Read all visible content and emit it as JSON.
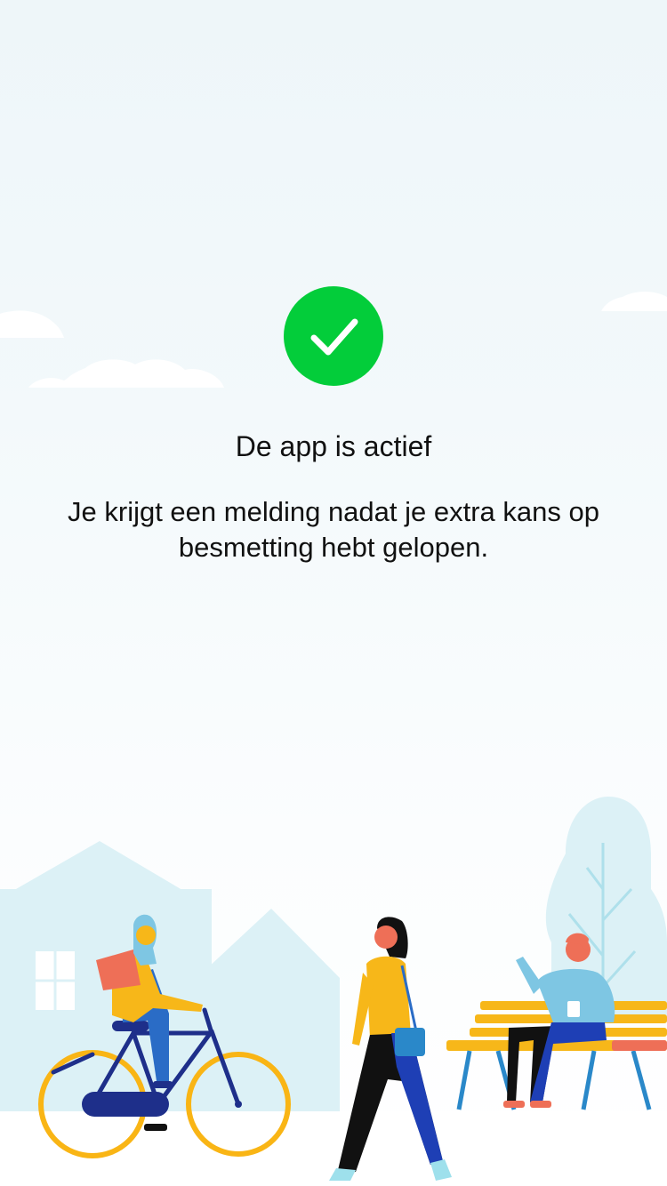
{
  "status": {
    "icon": "checkmark-icon",
    "color": "#03cd3a",
    "title": "De app is actief",
    "message": "Je krijgt een melding nadat je extra kans op besmetting hebt gelopen."
  }
}
